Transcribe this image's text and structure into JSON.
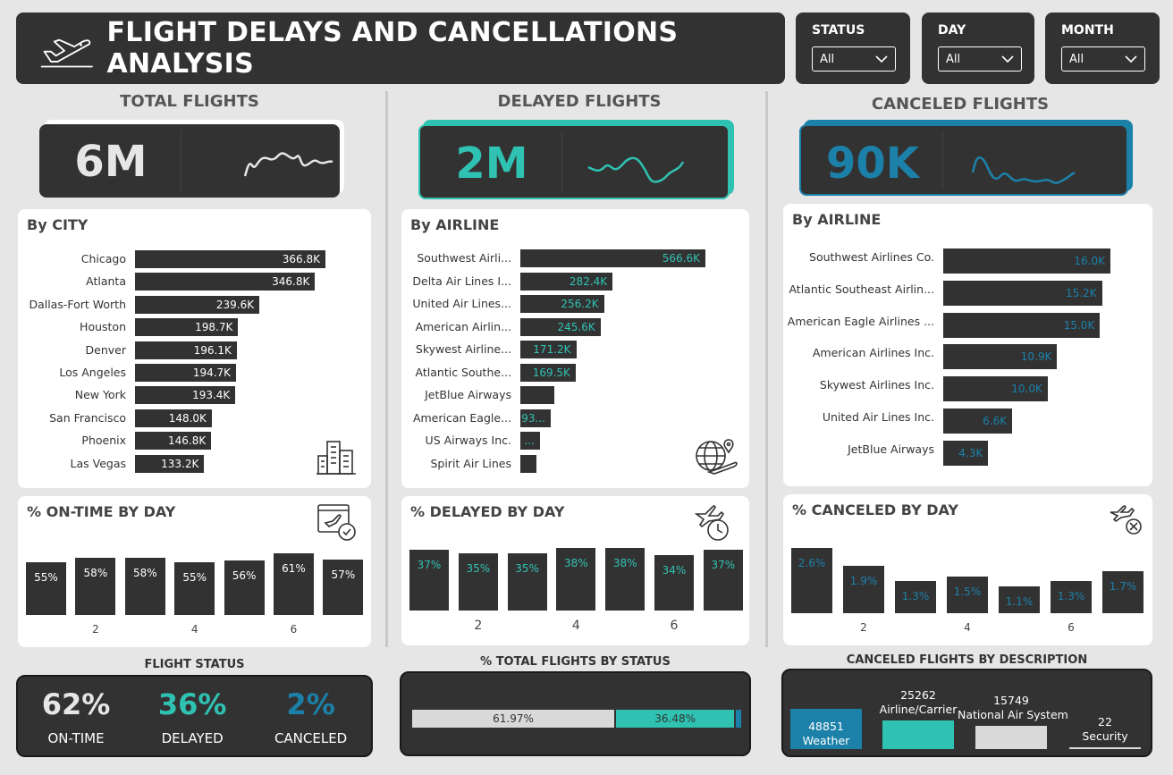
{
  "header": {
    "title": "FLIGHT DELAYS AND CANCELLATIONS ANALYSIS",
    "icon": "airplane-icon"
  },
  "slicers": [
    {
      "label": "STATUS",
      "value": "All"
    },
    {
      "label": "DAY",
      "value": "All"
    },
    {
      "label": "MONTH",
      "value": "All"
    }
  ],
  "colors": {
    "teal": "#2fc2b2",
    "blue": "#1b81a9",
    "dark": "#333233",
    "white": "#ffffff"
  },
  "total": {
    "title": "TOTAL FLIGHTS",
    "kpi": "6M",
    "card_title": "By CITY",
    "card_icon": "city-buildings-icon",
    "day_title": "% ON-TIME BY DAY",
    "day_icon": "flight-schedule-icon"
  },
  "delayed": {
    "title": "DELAYED FLIGHTS",
    "kpi": "2M",
    "card_title": "By AIRLINE",
    "card_icon": "globe-airplane-icon",
    "day_title": "% DELAYED BY DAY",
    "day_icon": "airplane-clock-icon"
  },
  "canceled": {
    "title": "CANCELED FLIGHTS",
    "kpi": "90K",
    "card_title": "By AIRLINE",
    "day_title": "% CANCELED BY DAY",
    "day_icon": "airplane-cancel-icon"
  },
  "chart_data": [
    {
      "type": "bar",
      "orientation": "horizontal",
      "title": "By CITY",
      "categories": [
        "Chicago",
        "Atlanta",
        "Dallas-Fort Worth",
        "Houston",
        "Denver",
        "Los Angeles",
        "New York",
        "San Francisco",
        "Phoenix",
        "Las Vegas"
      ],
      "values": [
        366.8,
        346.8,
        239.6,
        198.7,
        196.1,
        194.7,
        193.4,
        148.0,
        146.8,
        133.2
      ],
      "labels": [
        "366.8K",
        "346.8K",
        "239.6K",
        "198.7K",
        "196.1K",
        "194.7K",
        "193.4K",
        "148.0K",
        "146.8K",
        "133.2K"
      ]
    },
    {
      "type": "bar",
      "orientation": "horizontal",
      "title": "By AIRLINE",
      "categories": [
        "Southwest Airli...",
        "Delta Air Lines I...",
        "United Air Lines...",
        "American Airlin...",
        "Skywest Airline...",
        "Atlantic Southe...",
        "JetBlue Airways",
        "American Eagle...",
        "US Airways Inc.",
        "Spirit Air Lines"
      ],
      "values": [
        566.6,
        282.4,
        256.2,
        245.6,
        171.2,
        169.5,
        105.0,
        93.0,
        60.0,
        50.0
      ],
      "labels": [
        "566.6K",
        "282.4K",
        "256.2K",
        "245.6K",
        "171.2K",
        "169.5K",
        "",
        "93...",
        "...",
        ""
      ]
    },
    {
      "type": "bar",
      "orientation": "horizontal",
      "title": "By AIRLINE",
      "categories": [
        "Southwest Airlines Co.",
        "Atlantic Southeast Airlin...",
        "American Eagle Airlines ...",
        "American Airlines Inc.",
        "Skywest Airlines Inc.",
        "United Air Lines Inc.",
        "JetBlue Airways"
      ],
      "values": [
        16.0,
        15.2,
        15.0,
        10.9,
        10.0,
        6.6,
        4.3
      ],
      "labels": [
        "16.0K",
        "15.2K",
        "15.0K",
        "10.9K",
        "10.0K",
        "6.6K",
        "4.3K"
      ]
    },
    {
      "type": "bar",
      "title": "% ON-TIME BY DAY",
      "x": [
        1,
        2,
        3,
        4,
        5,
        6,
        7
      ],
      "values": [
        55,
        58,
        58,
        55,
        56,
        61,
        57
      ],
      "labels": [
        "55%",
        "58%",
        "58%",
        "55%",
        "56%",
        "61%",
        "57%"
      ],
      "tick_labels": [
        "2",
        "4",
        "6"
      ]
    },
    {
      "type": "bar",
      "title": "% DELAYED BY DAY",
      "x": [
        1,
        2,
        3,
        4,
        5,
        6,
        7
      ],
      "values": [
        37,
        35,
        35,
        38,
        38,
        34,
        37
      ],
      "labels": [
        "37%",
        "35%",
        "35%",
        "38%",
        "38%",
        "34%",
        "37%"
      ],
      "tick_labels": [
        "2",
        "4",
        "6"
      ]
    },
    {
      "type": "bar",
      "title": "% CANCELED BY DAY",
      "x": [
        1,
        2,
        3,
        4,
        5,
        6,
        7
      ],
      "values": [
        2.6,
        1.9,
        1.3,
        1.5,
        1.1,
        1.3,
        1.7
      ],
      "labels": [
        "2.6%",
        "1.9%",
        "1.3%",
        "1.5%",
        "1.1%",
        "1.3%",
        "1.7%"
      ],
      "tick_labels": [
        "2",
        "4",
        "6"
      ]
    },
    {
      "type": "bar",
      "orientation": "horizontal",
      "stacked": true,
      "title": "% TOTAL FLIGHTS BY STATUS",
      "series": [
        {
          "name": "ON-TIME",
          "value": 61.97,
          "label": "61.97%"
        },
        {
          "name": "DELAYED",
          "value": 36.48,
          "label": "36.48%"
        },
        {
          "name": "CANCELED",
          "value": 1.55,
          "label": ""
        }
      ]
    },
    {
      "type": "bar",
      "title": "CANCELED FLIGHTS BY DESCRIPTION",
      "categories": [
        "Weather",
        "Airline/Carrier",
        "National Air System",
        "Security"
      ],
      "values": [
        48851,
        25262,
        15749,
        22
      ],
      "labels": [
        "48851",
        "25262",
        "15749",
        "22"
      ]
    }
  ],
  "status": {
    "title": "FLIGHT STATUS",
    "items": [
      {
        "value": "62%",
        "label": "ON-TIME"
      },
      {
        "value": "36%",
        "label": "DELAYED"
      },
      {
        "value": "2%",
        "label": "CANCELED"
      }
    ]
  },
  "status_bar_title": "% TOTAL FLIGHTS BY STATUS",
  "desc_title": "CANCELED FLIGHTS BY DESCRIPTION"
}
